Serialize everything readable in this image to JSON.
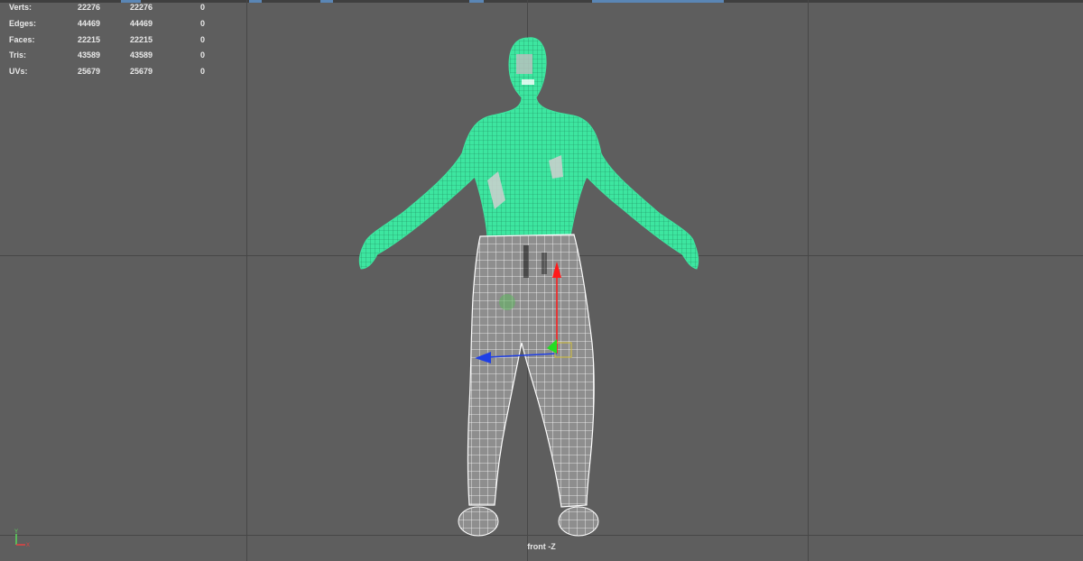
{
  "hud": {
    "rows": [
      {
        "label": "Verts:",
        "v1": "22276",
        "v2": "22276",
        "v3": "0"
      },
      {
        "label": "Edges:",
        "v1": "44469",
        "v2": "44469",
        "v3": "0"
      },
      {
        "label": "Faces:",
        "v1": "22215",
        "v2": "22215",
        "v3": "0"
      },
      {
        "label": "Tris:",
        "v1": "43589",
        "v2": "43589",
        "v3": "0"
      },
      {
        "label": "UVs:",
        "v1": "25679",
        "v2": "25679",
        "v3": "0"
      }
    ]
  },
  "viewport": {
    "camera_label": "front -Z",
    "background_color": "#5e5e5e",
    "grid_color": "#474747",
    "selection_color": "#3de6a0"
  },
  "axis_indicator": {
    "y_label": "Y",
    "x_label": "X",
    "y_color": "#5ad85a",
    "x_color": "#e64040"
  },
  "manipulator": {
    "x_axis_color": "#1f3fe6",
    "y_axis_color": "#ff1a1a",
    "center_color": "#22dd22",
    "plane_color": "#d6c33a"
  }
}
